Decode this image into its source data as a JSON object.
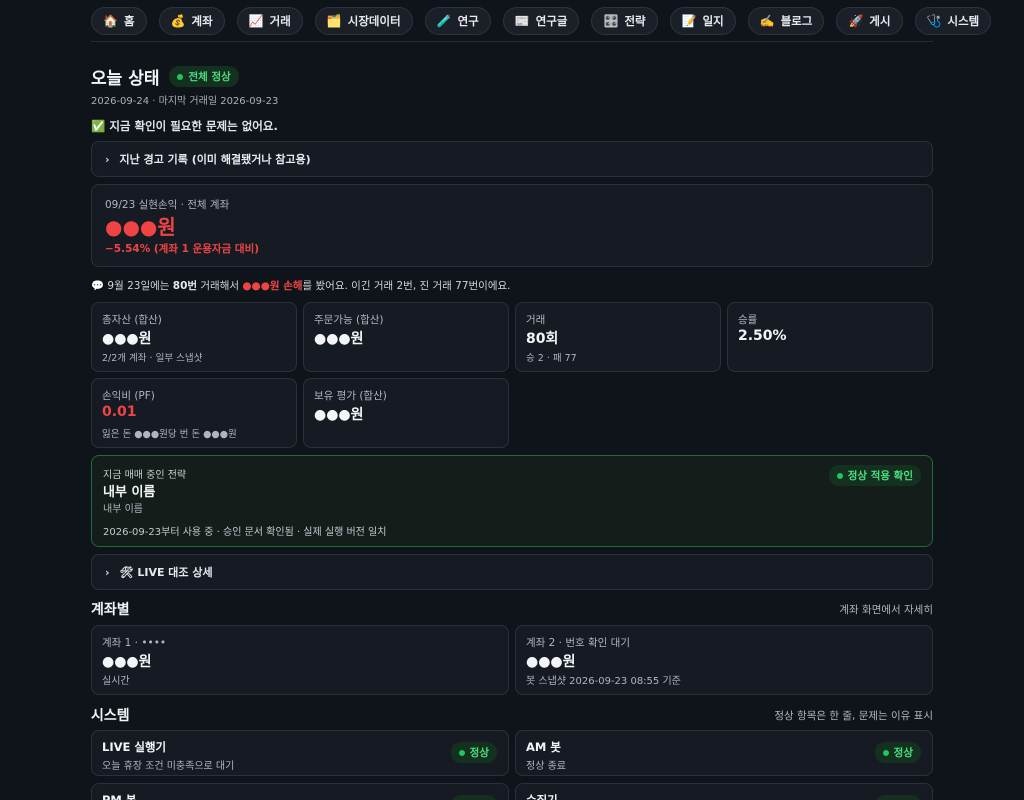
{
  "nav": [
    {
      "icon": "🏠",
      "label": "홈"
    },
    {
      "icon": "💰",
      "label": "계좌"
    },
    {
      "icon": "📈",
      "label": "거래"
    },
    {
      "icon": "🗂️",
      "label": "시장데이터"
    },
    {
      "icon": "🧪",
      "label": "연구"
    },
    {
      "icon": "📰",
      "label": "연구글"
    },
    {
      "icon": "🎛️",
      "label": "전략"
    },
    {
      "icon": "📝",
      "label": "일지"
    },
    {
      "icon": "✍️",
      "label": "블로그"
    },
    {
      "icon": "🚀",
      "label": "게시"
    },
    {
      "icon": "🩺",
      "label": "시스템"
    }
  ],
  "header": {
    "title": "오늘 상태",
    "status_badge": "전체 정상",
    "date_line": "2026-09-24 · 마지막 거래일 2026-09-23",
    "no_issue": "✅ 지금 확인이 필요한 문제는 없어요."
  },
  "past_alerts": {
    "label": "지난 경고 기록 (이미 해결됐거나 참고용)"
  },
  "pnl": {
    "label": "09/23 실현손익 · 전체 계좌",
    "value": "●●●원",
    "pct": "−5.54% (계좌 1 운용자금 대비)"
  },
  "summary": {
    "prefix": "💬 9월 23일에는 ",
    "trades": "80번",
    "mid": " 거래해서 ",
    "loss": "●●●원 손해",
    "suffix": "를 봤어요. 이긴 거래 2번, 진 거래 77번이에요."
  },
  "stats": [
    {
      "label": "총자산 (합산)",
      "value": "●●●원",
      "sub": "2/2개 계좌 · 일부 스냅샷"
    },
    {
      "label": "주문가능 (합산)",
      "value": "●●●원",
      "sub": ""
    },
    {
      "label": "거래",
      "value": "80회",
      "sub": "승 2 · 패 77"
    },
    {
      "label": "승률",
      "value": "2.50%",
      "sub": ""
    },
    {
      "label": "손익비 (PF)",
      "value": "0.01",
      "sub": "잃은 돈 ●●●원당 번 돈 ●●●원"
    },
    {
      "label": "보유 평가 (합산)",
      "value": "●●●원",
      "sub": ""
    }
  ],
  "strategy": {
    "label": "지금 매매 중인 전략",
    "name": "내부 이름",
    "sub": "내부 이름",
    "meta": "2026-09-23부터 사용 중 · 승인 문서 확인됨 · 실제 실행 버전 일치",
    "badge": "정상 적용 확인"
  },
  "live_detail": {
    "label": "🛠 LIVE 대조 상세"
  },
  "accounts": {
    "title": "계좌별",
    "hint": "계좌 화면에서 자세히",
    "items": [
      {
        "label": "계좌 1 · ••••",
        "value": "●●●원",
        "sub": "실시간"
      },
      {
        "label": "계좌 2 · 번호 확인 대기",
        "value": "●●●원",
        "sub": "봇 스냅샷 2026-09-23 08:55 기준"
      }
    ]
  },
  "system": {
    "title": "시스템",
    "hint": "정상 항목은 한 줄, 문제는 이유 표시",
    "items": [
      {
        "name": "LIVE 실행기",
        "sub": "오늘 휴장 조건 미충족으로 대기",
        "badge": "정상"
      },
      {
        "name": "AM 봇",
        "sub": "정상 종료",
        "badge": "정상"
      },
      {
        "name": "PM 봇",
        "sub": "",
        "badge": "정상"
      },
      {
        "name": "수집기",
        "sub": "",
        "badge": "정상"
      }
    ]
  },
  "colors": {
    "accent_green": "#22c55e",
    "loss_red": "#ef4444",
    "background": "#0f131a"
  }
}
